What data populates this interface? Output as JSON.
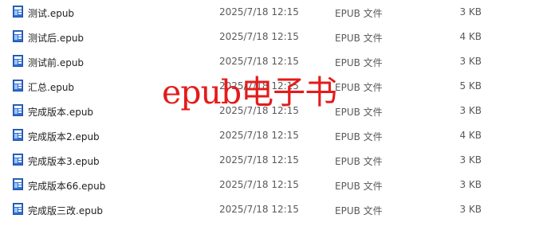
{
  "files": [
    {
      "name": "测试.epub",
      "modified": "2025/7/18 12:15",
      "type": "EPUB 文件",
      "size": "3 KB",
      "icon": "epub-file-icon"
    },
    {
      "name": "测试后.epub",
      "modified": "2025/7/18 12:15",
      "type": "EPUB 文件",
      "size": "4 KB",
      "icon": "epub-file-icon"
    },
    {
      "name": "测试前.epub",
      "modified": "2025/7/18 12:15",
      "type": "EPUB 文件",
      "size": "3 KB",
      "icon": "epub-file-icon"
    },
    {
      "name": "汇总.epub",
      "modified": "2025/7/18 12:15",
      "type": "EPUB 文件",
      "size": "5 KB",
      "icon": "epub-file-icon"
    },
    {
      "name": "完成版本.epub",
      "modified": "2025/7/18 12:15",
      "type": "EPUB 文件",
      "size": "3 KB",
      "icon": "epub-file-icon"
    },
    {
      "name": "完成版本2.epub",
      "modified": "2025/7/18 12:15",
      "type": "EPUB 文件",
      "size": "4 KB",
      "icon": "epub-file-icon"
    },
    {
      "name": "完成版本3.epub",
      "modified": "2025/7/18 12:15",
      "type": "EPUB 文件",
      "size": "3 KB",
      "icon": "epub-file-icon"
    },
    {
      "name": "完成版本66.epub",
      "modified": "2025/7/18 12:15",
      "type": "EPUB 文件",
      "size": "3 KB",
      "icon": "epub-file-icon"
    },
    {
      "name": "完成版三改.epub",
      "modified": "2025/7/18 12:15",
      "type": "EPUB 文件",
      "size": "3 KB",
      "icon": "epub-file-icon"
    }
  ],
  "overlay_text": "epub电子书",
  "colors": {
    "overlay": "#e41b1b",
    "icon_blue": "#2f6fd0",
    "icon_page": "#ffffff",
    "secondary_text": "#5a5a5a"
  }
}
